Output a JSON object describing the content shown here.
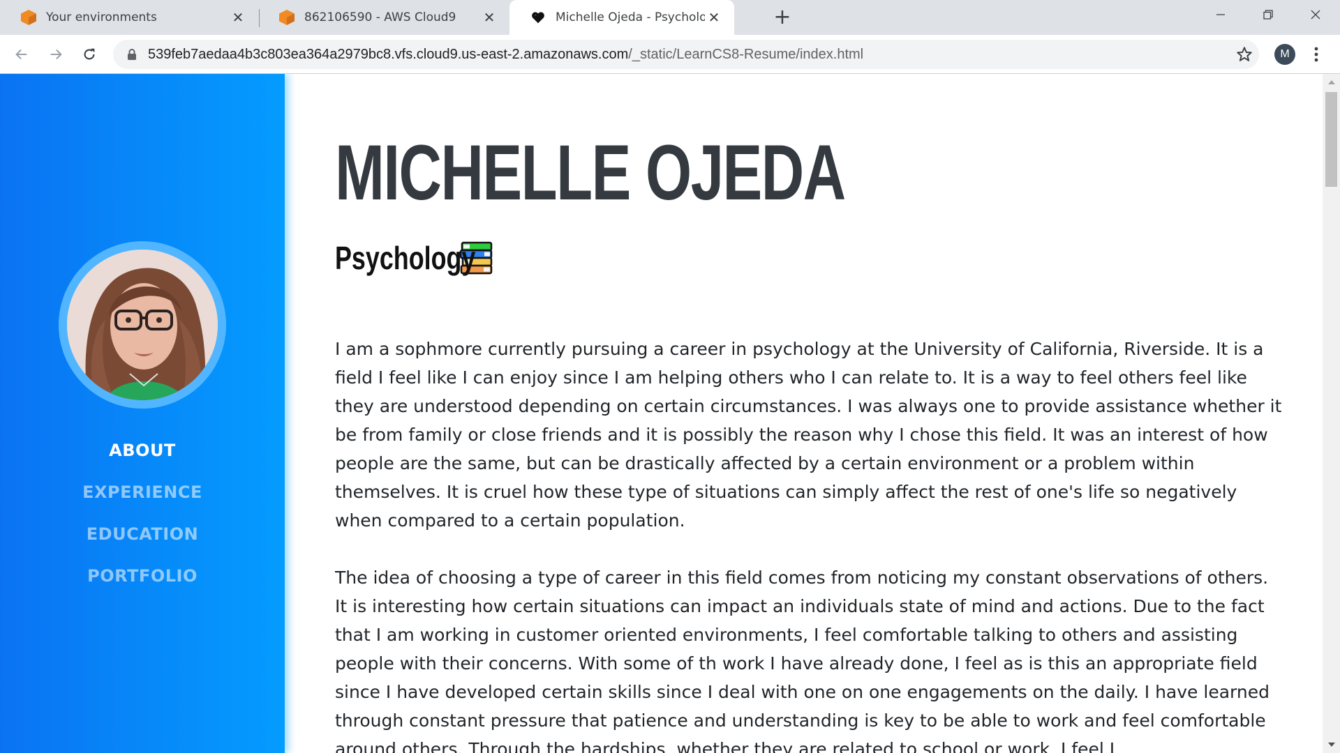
{
  "browser": {
    "tabs": [
      {
        "title": "Your environments",
        "icon": "aws-cloud9-icon",
        "active": false
      },
      {
        "title": "862106590 - AWS Cloud9",
        "icon": "aws-cloud9-icon",
        "active": false
      },
      {
        "title": "Michelle Ojeda - Psychology",
        "icon": "black-heart-icon",
        "active": true
      }
    ],
    "tab_close_glyph": "✕",
    "new_tab_glyph": "+",
    "url_host": "539feb7aedaa4b3c803ea364a2979bc8.vfs.cloud9.us-east-2.amazonaws.com",
    "url_path": "/_static/LearnCS8-Resume/index.html",
    "profile_initial": "M"
  },
  "sidebar": {
    "colors": {
      "start": "#0a73f2",
      "end": "#049cff"
    },
    "nav": [
      {
        "label": "ABOUT",
        "active": true
      },
      {
        "label": "EXPERIENCE",
        "active": false
      },
      {
        "label": "EDUCATION",
        "active": false
      },
      {
        "label": "PORTFOLIO",
        "active": false
      }
    ]
  },
  "main": {
    "name": "MICHELLE OJEDA",
    "subtitle": "Psychology",
    "subtitle_icon": "books-icon",
    "paragraphs": [
      "I am a sophmore currently pursuing a career in psychology at the University of California, Riverside. It is a field I feel like I can enjoy since I am helping others who I can relate to. It is a way to feel others feel like they are understood depending on certain circumstances. I was always one to provide assistance whether it be from family or close friends and it is possibly the reason why I chose this field. It was an interest of how people are the same, but can be drastically affected by a certain environment or a problem within themselves. It is cruel how these type of situations can simply affect the rest of one's life so negatively when compared to a certain population.",
      "The idea of choosing a type of career in this field comes from noticing my constant observations of others. It is interesting how certain situations can impact an individuals state of mind and actions. Due to the fact that I am working in customer oriented environments, I feel comfortable talking to others and assisting people with their concerns. With some of th work I have already done, I feel as is this an appropriate field since I have developed certain skills since I deal with one on one engagements on the daily. I have learned through constant pressure that patience and understanding is key to be able to work and feel comfortable around others. Through the hardships, whether they are related to school or work, I feel I"
    ]
  }
}
